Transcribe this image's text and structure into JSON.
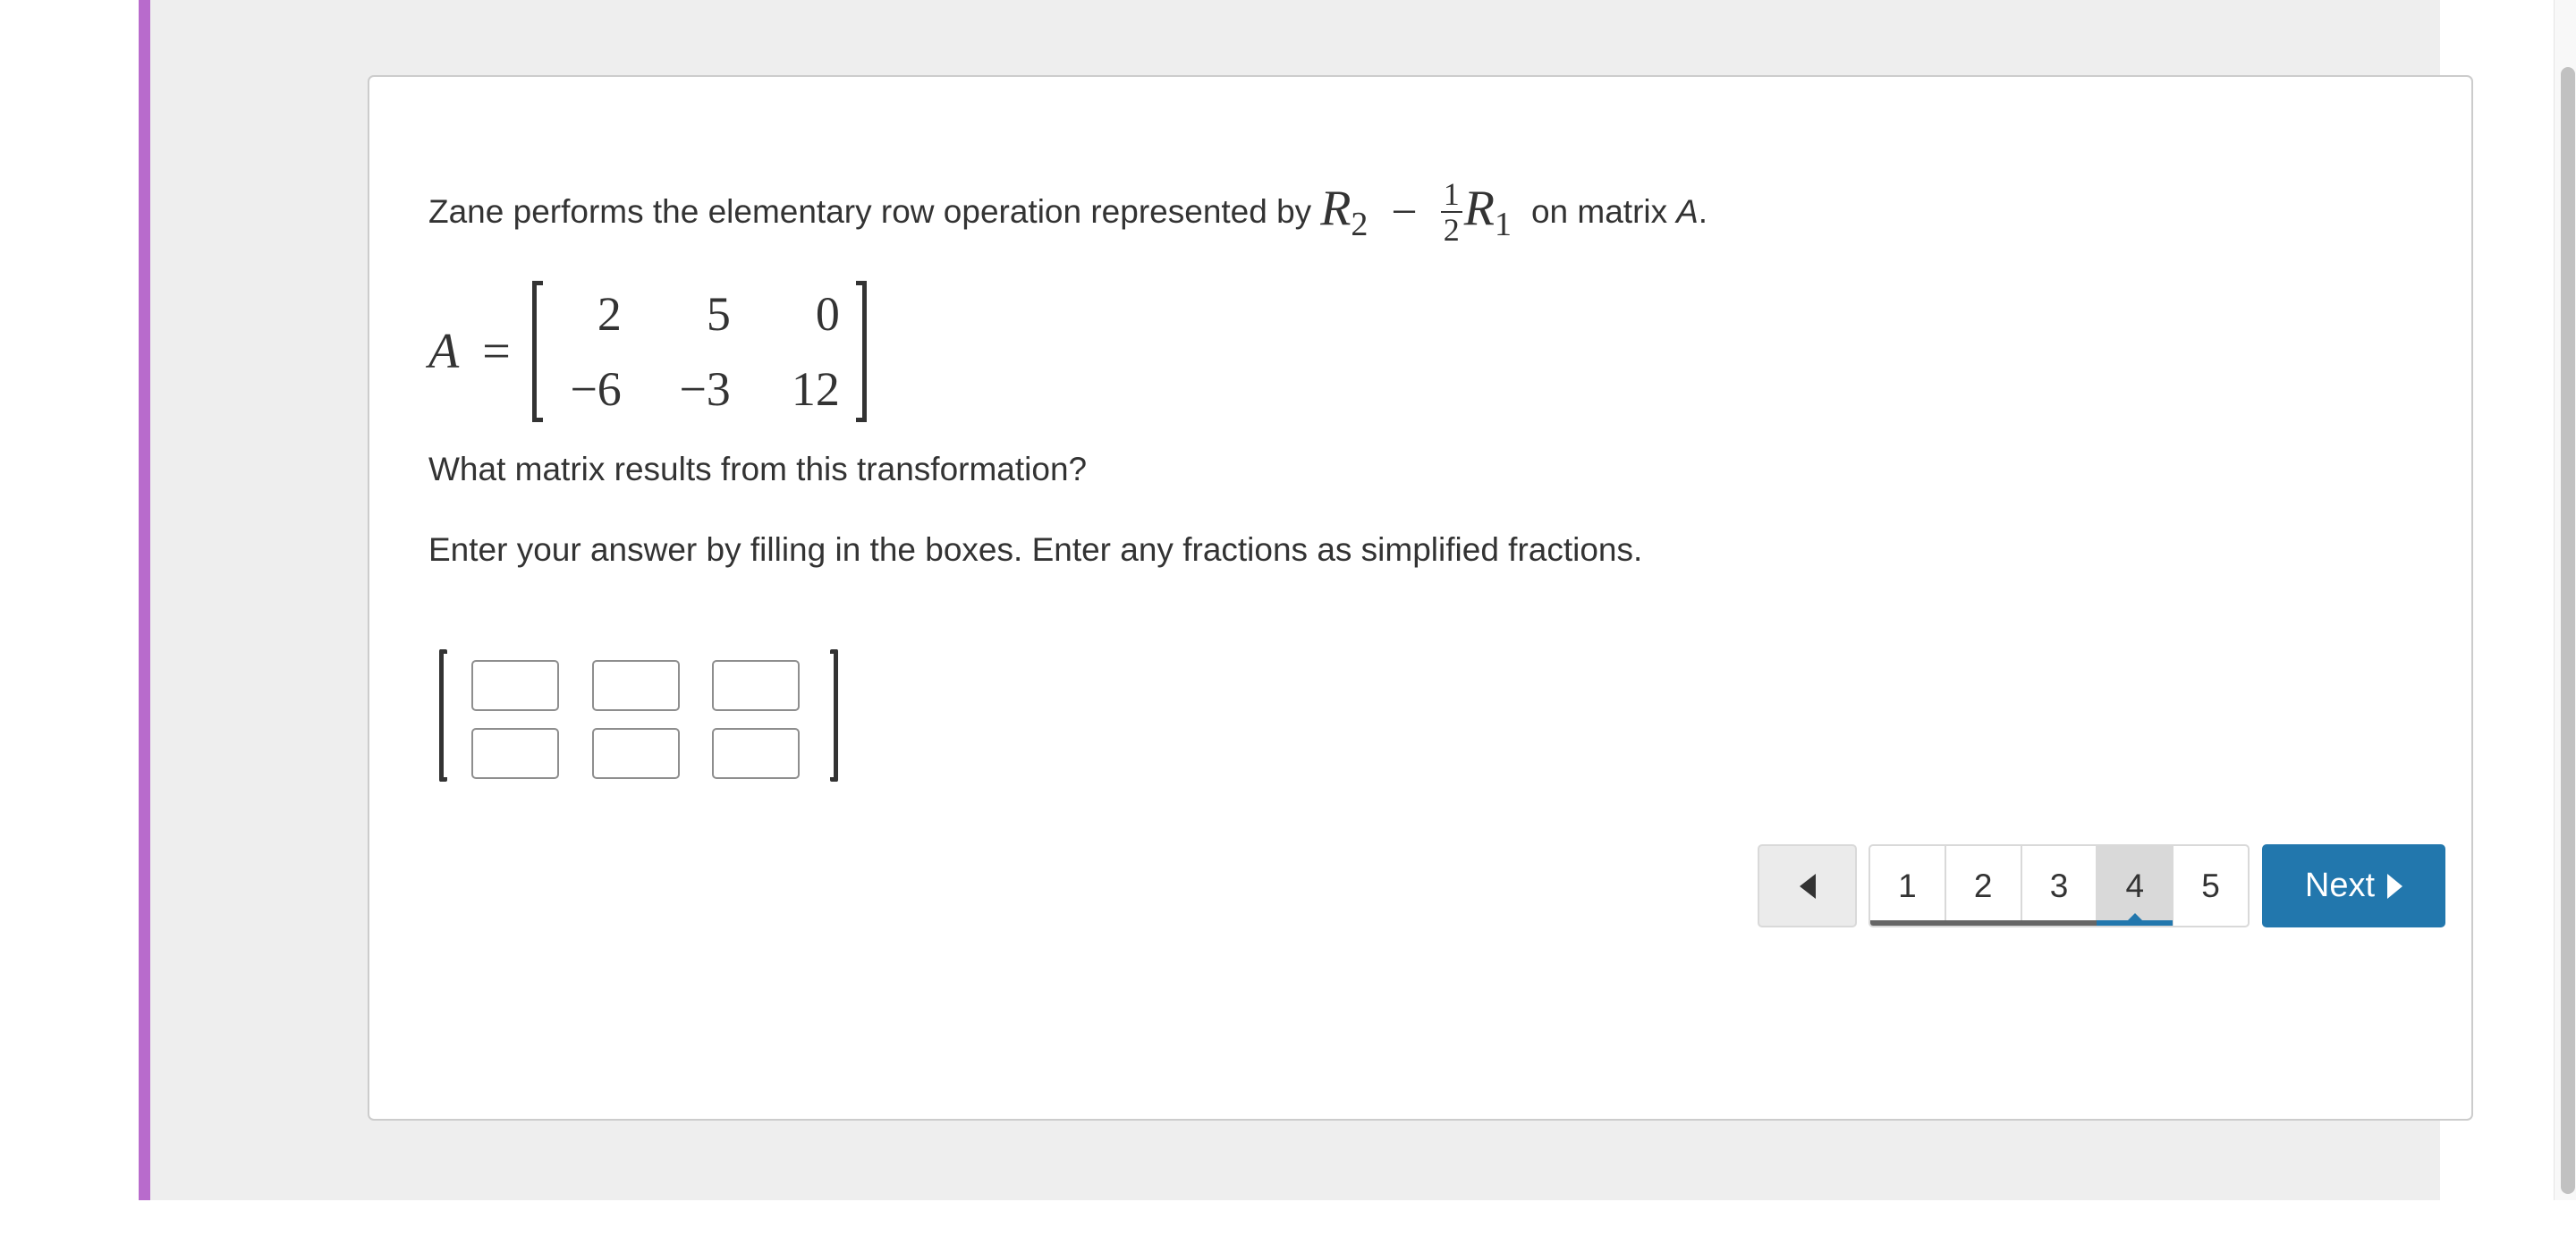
{
  "question": {
    "intro_text": "Zane performs the elementary row operation represented by",
    "operation": {
      "target_row": "R",
      "target_row_sub": "2",
      "operator": "−",
      "coefficient_numerator": "1",
      "coefficient_denominator": "2",
      "source_row": "R",
      "source_row_sub": "1"
    },
    "suffix_text": "on matrix",
    "matrix_name": "A",
    "suffix_period": "."
  },
  "matrix_A": {
    "label": "A",
    "equals": "=",
    "rows": [
      [
        "2",
        "5",
        "0"
      ],
      [
        "−6",
        "−3",
        "12"
      ]
    ]
  },
  "prompt": "What matrix results from this transformation?",
  "instructions": "Enter your answer by filling in the boxes. Enter any fractions as simplified fractions.",
  "answer_matrix": {
    "rows": 2,
    "cols": 3,
    "values": [
      [
        "",
        "",
        ""
      ],
      [
        "",
        "",
        ""
      ]
    ]
  },
  "navigation": {
    "prev_icon": "triangle-left-icon",
    "pages": [
      {
        "label": "1",
        "state": "done"
      },
      {
        "label": "2",
        "state": "done"
      },
      {
        "label": "3",
        "state": "done"
      },
      {
        "label": "4",
        "state": "current"
      },
      {
        "label": "5",
        "state": "todo"
      }
    ],
    "current_page": 4,
    "next_label": "Next",
    "next_icon": "triangle-right-icon"
  },
  "colors": {
    "accent_bar": "#b86bcc",
    "primary_button": "#2277ad",
    "progress_done": "#666666",
    "progress_current": "#2277ad"
  }
}
